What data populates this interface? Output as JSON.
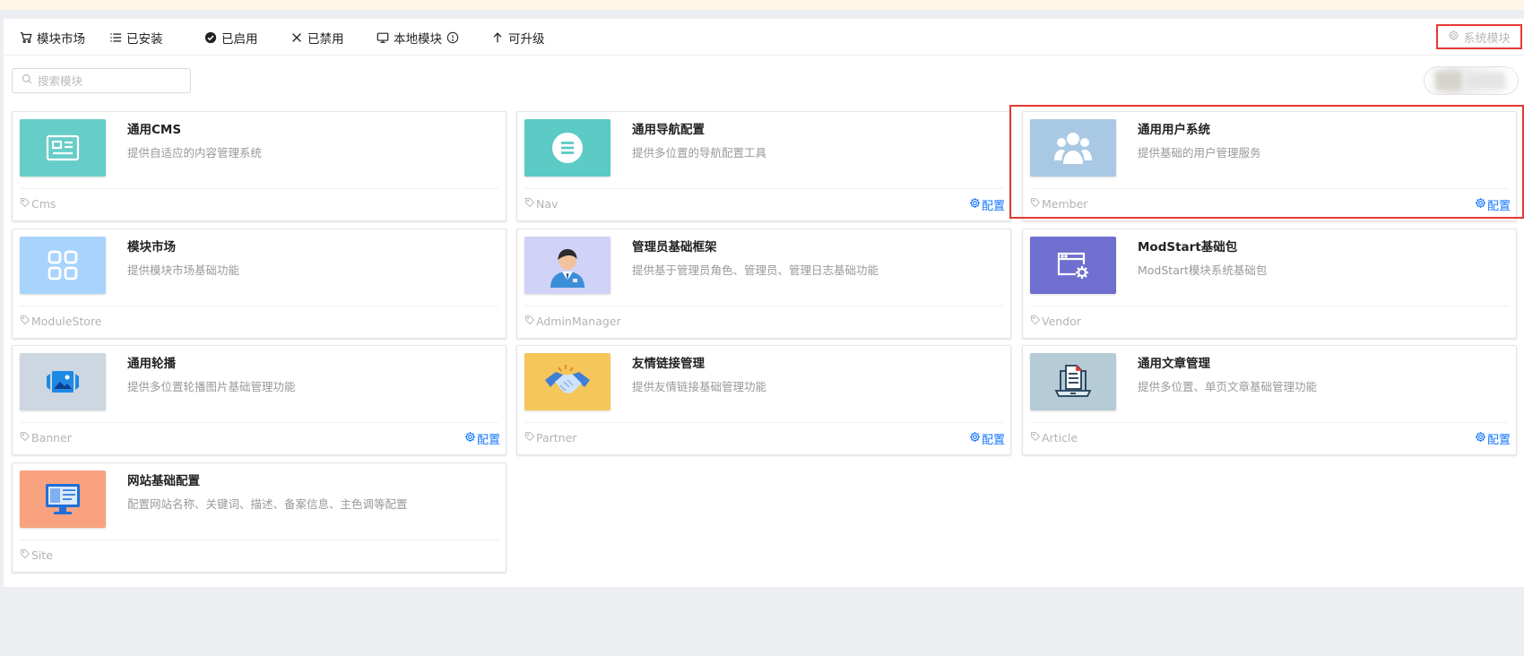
{
  "tabs": {
    "items": [
      {
        "label": "模块市场",
        "icon": "cart-icon"
      },
      {
        "label": "已安装",
        "icon": "list-icon"
      },
      {
        "label": "已启用",
        "icon": "check-circle-icon"
      },
      {
        "label": "已禁用",
        "icon": "close-icon"
      },
      {
        "label": "本地模块",
        "icon": "monitor-icon"
      },
      {
        "label": "可升级",
        "icon": "arrow-up-icon"
      }
    ],
    "system_label": "系统模块"
  },
  "search": {
    "placeholder": "搜索模块"
  },
  "colors": {
    "accent": "#1677ff",
    "highlight": "#e53935",
    "banner": "#fdf6e7"
  },
  "modules": [
    {
      "title": "通用CMS",
      "desc": "提供自适应的内容管理系统",
      "tag": "Cms",
      "has_config": false,
      "thumb_color": "#67cdc8",
      "icon": "cms-card-icon"
    },
    {
      "title": "通用导航配置",
      "desc": "提供多位置的导航配置工具",
      "tag": "Nav",
      "has_config": true,
      "config_label": "配置",
      "thumb_color": "#5ccac5",
      "icon": "nav-menu-icon"
    },
    {
      "title": "通用用户系统",
      "desc": "提供基础的用户管理服务",
      "tag": "Member",
      "has_config": true,
      "config_label": "配置",
      "thumb_color": "#a9c8e4",
      "icon": "users-icon"
    },
    {
      "title": "模块市场",
      "desc": "提供模块市场基础功能",
      "tag": "ModuleStore",
      "has_config": false,
      "thumb_color": "#a8d3fc",
      "icon": "grid-apps-icon"
    },
    {
      "title": "管理员基础框架",
      "desc": "提供基于管理员角色、管理员、管理日志基础功能",
      "tag": "AdminManager",
      "has_config": false,
      "thumb_color": "#d0d2f7",
      "icon": "admin-avatar-icon"
    },
    {
      "title": "ModStart基础包",
      "desc": "ModStart模块系统基础包",
      "tag": "Vendor",
      "has_config": false,
      "thumb_color": "#6f6fd0",
      "icon": "window-gear-icon"
    },
    {
      "title": "通用轮播",
      "desc": "提供多位置轮播图片基础管理功能",
      "tag": "Banner",
      "has_config": true,
      "config_label": "配置",
      "thumb_color": "#ccd7e2",
      "icon": "image-carousel-icon"
    },
    {
      "title": "友情链接管理",
      "desc": "提供友情链接基础管理功能",
      "tag": "Partner",
      "has_config": true,
      "config_label": "配置",
      "thumb_color": "#f5c65a",
      "icon": "handshake-icon"
    },
    {
      "title": "通用文章管理",
      "desc": "提供多位置、单页文章基础管理功能",
      "tag": "Article",
      "has_config": true,
      "config_label": "配置",
      "thumb_color": "#b5ccd7",
      "icon": "laptop-document-icon"
    },
    {
      "title": "网站基础配置",
      "desc": "配置网站名称、关键词、描述、备案信息、主色调等配置",
      "tag": "Site",
      "has_config": false,
      "thumb_color": "#f8a27f",
      "icon": "monitor-website-icon"
    }
  ]
}
